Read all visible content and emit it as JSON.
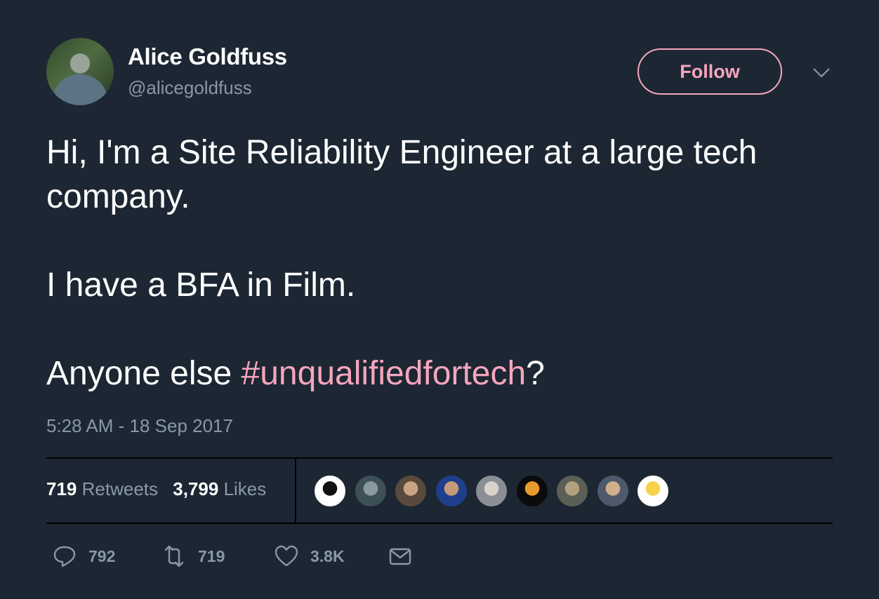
{
  "user": {
    "name": "Alice Goldfuss",
    "handle": "@alicegoldfuss"
  },
  "follow_label": "Follow",
  "tweet": {
    "line1": "Hi, I'm a Site Reliability Engineer at a large tech company.",
    "line2": "I have a BFA in Film.",
    "line3_prefix": "Anyone else ",
    "hashtag": "#unqualifiedfortech",
    "line3_suffix": "?"
  },
  "timestamp": "5:28 AM - 18 Sep 2017",
  "stats": {
    "retweets_count": "719",
    "retweets_label": "Retweets",
    "likes_count": "3,799",
    "likes_label": "Likes"
  },
  "liker_avatars": [
    {
      "color": "#ffffff",
      "accent": "#111111"
    },
    {
      "color": "#3d4f57",
      "accent": "#8a9aa0"
    },
    {
      "color": "#5a4a3c",
      "accent": "#c9a585"
    },
    {
      "color": "#1e3f8a",
      "accent": "#c69a78"
    },
    {
      "color": "#8a8f96",
      "accent": "#d9d2c8"
    },
    {
      "color": "#0b0b0b",
      "accent": "#e89a2c"
    },
    {
      "color": "#5b5f55",
      "accent": "#b3a07e"
    },
    {
      "color": "#4e5a6b",
      "accent": "#d0b08a"
    },
    {
      "color": "#ffffff",
      "accent": "#f7d24b"
    }
  ],
  "actions": {
    "replies": "792",
    "retweets": "719",
    "likes": "3.8K"
  },
  "colors": {
    "background": "#1c2733",
    "accent": "#f6a5bd",
    "muted": "#8899a6"
  }
}
